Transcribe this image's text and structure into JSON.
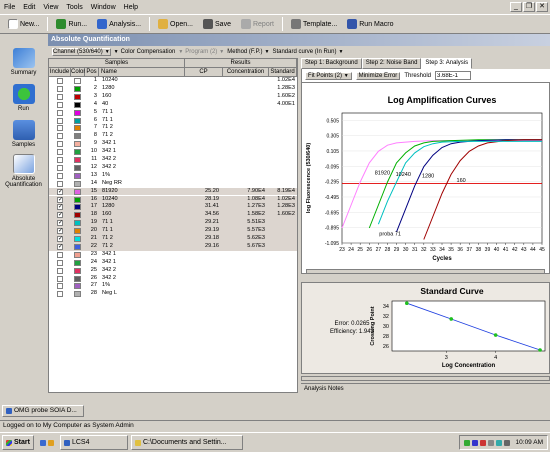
{
  "menubar": {
    "items": [
      "File",
      "Edit",
      "View",
      "Tools",
      "Window",
      "Help"
    ]
  },
  "toolbar": {
    "buttons": [
      {
        "label": "New...",
        "icon": "new-icon",
        "color": "#ffffff"
      },
      {
        "label": "Run...",
        "icon": "run-icon",
        "color": "#2e8b2e"
      },
      {
        "label": "Analysis...",
        "icon": "analysis-icon",
        "color": "#3366cc"
      },
      {
        "label": "Open...",
        "icon": "open-icon",
        "color": "#e0b040"
      },
      {
        "label": "Save",
        "icon": "save-icon",
        "color": "#555555"
      },
      {
        "label": "Report",
        "icon": "report-icon",
        "color": "#999999",
        "disabled": true
      },
      {
        "label": "Template...",
        "icon": "template-icon",
        "color": "#777777"
      },
      {
        "label": "Run Macro",
        "icon": "macro-icon",
        "color": "#3355aa"
      }
    ]
  },
  "leftnav": {
    "items": [
      "Summary",
      "Run",
      "Samples",
      "Absolute Quantification"
    ]
  },
  "module_title": "Absolute Quantification",
  "selectors": {
    "channel": "Channel (530/640)",
    "compensation": "Color Compensation",
    "program": "Program (2)",
    "method": "Method (F.P.)",
    "standard_curve": "Standard curve (In Run)"
  },
  "grid": {
    "group_samples": "Samples",
    "group_results": "Results",
    "columns": [
      "Include",
      "Color",
      "Pos",
      "Name",
      "CP",
      "Concentration",
      "Standard"
    ],
    "rows": [
      {
        "inc": false,
        "color": "#ffffff",
        "pos": "1",
        "name": "10240",
        "cp": "",
        "conc": "",
        "std": "1.02E4",
        "sel": false
      },
      {
        "inc": false,
        "color": "#00a000",
        "pos": "2",
        "name": "1280",
        "cp": "",
        "conc": "",
        "std": "1.28E3",
        "sel": false
      },
      {
        "inc": false,
        "color": "#c00000",
        "pos": "3",
        "name": "160",
        "cp": "",
        "conc": "",
        "std": "1.60E2",
        "sel": false
      },
      {
        "inc": false,
        "color": "#000000",
        "pos": "4",
        "name": "40",
        "cp": "",
        "conc": "",
        "std": "4.00E1",
        "sel": false
      },
      {
        "inc": false,
        "color": "#e000e0",
        "pos": "5",
        "name": "71 1",
        "cp": "",
        "conc": "",
        "std": "",
        "sel": false
      },
      {
        "inc": false,
        "color": "#00a0a0",
        "pos": "6",
        "name": "71 1",
        "cp": "",
        "conc": "",
        "std": "",
        "sel": false
      },
      {
        "inc": false,
        "color": "#e08000",
        "pos": "7",
        "name": "71 2",
        "cp": "",
        "conc": "",
        "std": "",
        "sel": false
      },
      {
        "inc": false,
        "color": "#808080",
        "pos": "8",
        "name": "71 2",
        "cp": "",
        "conc": "",
        "std": "",
        "sel": false
      },
      {
        "inc": false,
        "color": "#f4b0a0",
        "pos": "9",
        "name": "342 1",
        "cp": "",
        "conc": "",
        "std": "",
        "sel": false
      },
      {
        "inc": false,
        "color": "#20a040",
        "pos": "10",
        "name": "342 1",
        "cp": "",
        "conc": "",
        "std": "",
        "sel": false
      },
      {
        "inc": false,
        "color": "#e03060",
        "pos": "11",
        "name": "342 2",
        "cp": "",
        "conc": "",
        "std": "",
        "sel": false
      },
      {
        "inc": false,
        "color": "#606060",
        "pos": "12",
        "name": "342 2",
        "cp": "",
        "conc": "",
        "std": "",
        "sel": false
      },
      {
        "inc": false,
        "color": "#a060c0",
        "pos": "13",
        "name": "1%",
        "cp": "",
        "conc": "",
        "std": "",
        "sel": false
      },
      {
        "inc": false,
        "color": "#b0b0b0",
        "pos": "14",
        "name": "Neg RR",
        "cp": "",
        "conc": "",
        "std": "",
        "sel": false
      },
      {
        "inc": true,
        "color": "#e060e0",
        "pos": "15",
        "name": "81920",
        "cp": "25.20",
        "conc": "7.90E4",
        "std": "8.19E4",
        "sel": true
      },
      {
        "inc": true,
        "color": "#00a000",
        "pos": "16",
        "name": "10240",
        "cp": "28.19",
        "conc": "1.08E4",
        "std": "1.02E4",
        "sel": true
      },
      {
        "inc": true,
        "color": "#000080",
        "pos": "17",
        "name": "1280",
        "cp": "31.41",
        "conc": "1.27E3",
        "std": "1.28E3",
        "sel": true
      },
      {
        "inc": true,
        "color": "#a00000",
        "pos": "18",
        "name": "160",
        "cp": "34.56",
        "conc": "1.58E2",
        "std": "1.60E2",
        "sel": true
      },
      {
        "inc": true,
        "color": "#00c0c0",
        "pos": "19",
        "name": "71 1",
        "cp": "29.21",
        "conc": "5.51E3",
        "std": "",
        "sel": true
      },
      {
        "inc": true,
        "color": "#e08000",
        "pos": "20",
        "name": "71 1",
        "cp": "29.19",
        "conc": "5.57E3",
        "std": "",
        "sel": true
      },
      {
        "inc": true,
        "color": "#00e0e0",
        "pos": "21",
        "name": "71 2",
        "cp": "29.18",
        "conc": "5.62E3",
        "std": "",
        "sel": true
      },
      {
        "inc": true,
        "color": "#4060e0",
        "pos": "22",
        "name": "71 2",
        "cp": "29.16",
        "conc": "5.67E3",
        "std": "",
        "sel": true
      },
      {
        "inc": false,
        "color": "#f0a090",
        "pos": "23",
        "name": "342 1",
        "cp": "",
        "conc": "",
        "std": "",
        "sel": false
      },
      {
        "inc": false,
        "color": "#20a040",
        "pos": "24",
        "name": "342 1",
        "cp": "",
        "conc": "",
        "std": "",
        "sel": false
      },
      {
        "inc": false,
        "color": "#e03060",
        "pos": "25",
        "name": "342 2",
        "cp": "",
        "conc": "",
        "std": "",
        "sel": false
      },
      {
        "inc": false,
        "color": "#606060",
        "pos": "26",
        "name": "342 2",
        "cp": "",
        "conc": "",
        "std": "",
        "sel": false
      },
      {
        "inc": false,
        "color": "#a060c0",
        "pos": "27",
        "name": "1%",
        "cp": "",
        "conc": "",
        "std": "",
        "sel": false
      },
      {
        "inc": false,
        "color": "#b0b0b0",
        "pos": "28",
        "name": "Neg L",
        "cp": "",
        "conc": "",
        "std": "",
        "sel": false
      }
    ]
  },
  "tabs": [
    "Step 1: Background",
    "Step 2: Noise Band",
    "Step 3: Analysis"
  ],
  "active_tab": 2,
  "fit": {
    "fit_points": "Fit Points (2)",
    "minimize_error": "Minimize Error",
    "threshold_label": "Threshold",
    "threshold_value": "3.68E-1"
  },
  "chart_data": [
    {
      "type": "line",
      "title": "Log Amplification Curves",
      "xlabel": "Cycles",
      "ylabel": "log Fluorescence (530/640)",
      "xlim": [
        23,
        45
      ],
      "ylim": [
        -1.095,
        0.6
      ],
      "xticks": [
        23,
        24,
        25,
        26,
        27,
        28,
        29,
        30,
        31,
        32,
        33,
        34,
        35,
        36,
        37,
        38,
        39,
        40,
        41,
        42,
        43,
        44,
        45
      ],
      "yticks": [
        0.505,
        0.305,
        0.105,
        -0.095,
        -0.295,
        -0.495,
        -0.695,
        -0.895,
        -1.095
      ],
      "threshold": -0.32,
      "annotations": [
        "81920",
        "10240",
        "1280",
        "160",
        "proba 71"
      ],
      "series": [
        {
          "name": "81920",
          "color": "#ff80ff",
          "x": [
            23,
            24,
            25,
            26,
            27,
            28,
            29,
            30,
            31,
            33,
            35,
            37,
            40,
            45
          ],
          "y": [
            -0.9,
            -0.6,
            -0.3,
            -0.05,
            0.1,
            0.18,
            0.21,
            0.22,
            0.23,
            0.24,
            0.24,
            0.24,
            0.24,
            0.24
          ]
        },
        {
          "name": "10240",
          "color": "#00b000",
          "x": [
            26,
            27,
            28,
            29,
            30,
            31,
            32,
            33,
            35,
            38,
            42,
            45
          ],
          "y": [
            -0.9,
            -0.6,
            -0.3,
            -0.05,
            0.08,
            0.17,
            0.21,
            0.23,
            0.24,
            0.25,
            0.25,
            0.25
          ]
        },
        {
          "name": "1280",
          "color": "#000080",
          "x": [
            29,
            30,
            31,
            32,
            33,
            34,
            35,
            36,
            38,
            41,
            45
          ],
          "y": [
            -0.95,
            -0.65,
            -0.35,
            -0.1,
            0.05,
            0.15,
            0.2,
            0.22,
            0.24,
            0.25,
            0.25
          ]
        },
        {
          "name": "160",
          "color": "#a00000",
          "x": [
            32,
            33,
            34,
            35,
            36,
            37,
            38,
            39,
            41,
            43,
            45
          ],
          "y": [
            -1.05,
            -0.75,
            -0.45,
            -0.2,
            -0.02,
            0.1,
            0.17,
            0.21,
            0.24,
            0.25,
            0.25
          ]
        },
        {
          "name": "proba 71",
          "color": "#00c0c0",
          "x": [
            27,
            28,
            29,
            30,
            31,
            32,
            33,
            34,
            36,
            39,
            45
          ],
          "y": [
            -0.85,
            -0.55,
            -0.3,
            -0.05,
            0.08,
            0.16,
            0.2,
            0.22,
            0.23,
            0.23,
            0.23
          ]
        }
      ]
    },
    {
      "type": "scatter",
      "title": "Standard Curve",
      "xlabel": "Log Concentration",
      "ylabel": "Crossing Point",
      "xlim": [
        1.9,
        5.0
      ],
      "ylim": [
        25,
        35
      ],
      "xticks": [
        3,
        4
      ],
      "yticks": [
        26,
        28,
        30,
        32,
        34
      ],
      "points": {
        "x": [
          2.2,
          3.1,
          4.0,
          4.9
        ],
        "y": [
          34.56,
          31.41,
          28.19,
          25.2
        ]
      },
      "error_label": "Error: 0.0265",
      "efficiency_label": "Efficiency: 1.943"
    }
  ],
  "analysis_notes": "Analysis Notes",
  "document_tab": "OMG probe SOIA D...",
  "status_text": "Logged on to My Computer as System Admin",
  "taskbar": {
    "start": "Start",
    "tasks": [
      "LCS4",
      "C:\\Documents and Settin..."
    ],
    "clock": "10:09 AM"
  }
}
